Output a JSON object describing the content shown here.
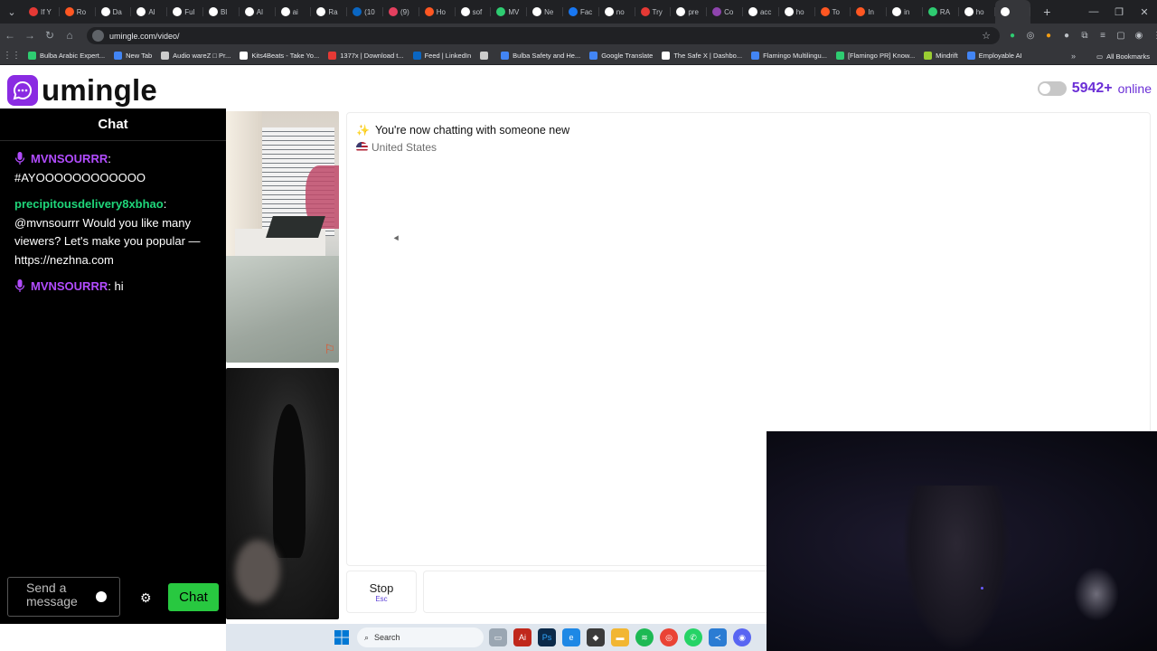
{
  "browser": {
    "tabs": [
      {
        "label": "If Y",
        "color": "#e53935"
      },
      {
        "label": "Ro",
        "color": "#ff5722"
      },
      {
        "label": "Da",
        "color": "#ffffff"
      },
      {
        "label": "Al",
        "color": "#ffffff"
      },
      {
        "label": "Ful",
        "color": "#ffffff"
      },
      {
        "label": "Bl",
        "color": "#ffffff"
      },
      {
        "label": "Al",
        "color": "#ffffff"
      },
      {
        "label": "ai",
        "color": "#ffffff"
      },
      {
        "label": "Ra",
        "color": "#ffffff"
      },
      {
        "label": "(10",
        "color": "#0a66c2"
      },
      {
        "label": "(9)",
        "color": "#e4405f"
      },
      {
        "label": "Ho",
        "color": "#ff5722"
      },
      {
        "label": "sof",
        "color": "#ffffff"
      },
      {
        "label": "MV",
        "color": "#2ecc71"
      },
      {
        "label": "Ne",
        "color": "#ffffff"
      },
      {
        "label": "Fac",
        "color": "#1877f2"
      },
      {
        "label": "no",
        "color": "#ffffff"
      },
      {
        "label": "Try",
        "color": "#e53935"
      },
      {
        "label": "pre",
        "color": "#ffffff"
      },
      {
        "label": "Co",
        "color": "#8e44ad"
      },
      {
        "label": "acc",
        "color": "#ffffff"
      },
      {
        "label": "ho",
        "color": "#ffffff"
      },
      {
        "label": "To",
        "color": "#ff5722"
      },
      {
        "label": "In",
        "color": "#ff5722"
      },
      {
        "label": "in",
        "color": "#ffffff"
      },
      {
        "label": "RA",
        "color": "#2ecc71"
      },
      {
        "label": "ho",
        "color": "#ffffff"
      },
      {
        "label": "",
        "color": "#ffffff"
      }
    ],
    "url": "umingle.com/video/",
    "bookmarks": [
      {
        "label": "Bulba Arabic Expert...",
        "color": "#2ecc71"
      },
      {
        "label": "New Tab",
        "color": "#4285f4"
      },
      {
        "label": "Audio wareZ □ Pr...",
        "color": "#cccccc"
      },
      {
        "label": "Kits4Beats - Take Yo...",
        "color": "#ffffff"
      },
      {
        "label": "1377x | Download t...",
        "color": "#e53935"
      },
      {
        "label": "Feed | LinkedIn",
        "color": "#0a66c2"
      },
      {
        "label": "",
        "color": "#cccccc"
      },
      {
        "label": "Bulba Safety and He...",
        "color": "#4285f4"
      },
      {
        "label": "Google Translate",
        "color": "#4285f4"
      },
      {
        "label": "The Safe X | Dashbo...",
        "color": "#ffffff"
      },
      {
        "label": "Flamingo Multilingu...",
        "color": "#4285f4"
      },
      {
        "label": "[Flamingo PR] Know...",
        "color": "#2ecc71"
      },
      {
        "label": "Mindrift",
        "color": "#9acd32"
      },
      {
        "label": "Employable AI",
        "color": "#4285f4"
      }
    ],
    "all_bookmarks": "All Bookmarks"
  },
  "site": {
    "brand": "umingle",
    "online_count": "5942+",
    "online_label": "online"
  },
  "chat": {
    "title": "Chat",
    "messages": [
      {
        "user": "MVNSOURRR",
        "text": "#AYOOOOOOOOOOOO",
        "mic": true,
        "color": "#b24cff"
      },
      {
        "user": "precipitousdelivery8xbhao",
        "text": "@mvnsourrr Would you like many viewers? Let's make you popular — https://nezhna.com",
        "mic": false,
        "color": "#1fd67a"
      },
      {
        "user": "MVNSOURRR",
        "text": "hi",
        "mic": true,
        "color": "#b24cff"
      }
    ],
    "input_placeholder": "Send a message",
    "send_label": "Chat"
  },
  "main": {
    "status": "You're now chatting with someone new",
    "country": "United States",
    "stop_label": "Stop",
    "stop_hint": "Esc"
  },
  "taskbar": {
    "search_label": "Search"
  }
}
